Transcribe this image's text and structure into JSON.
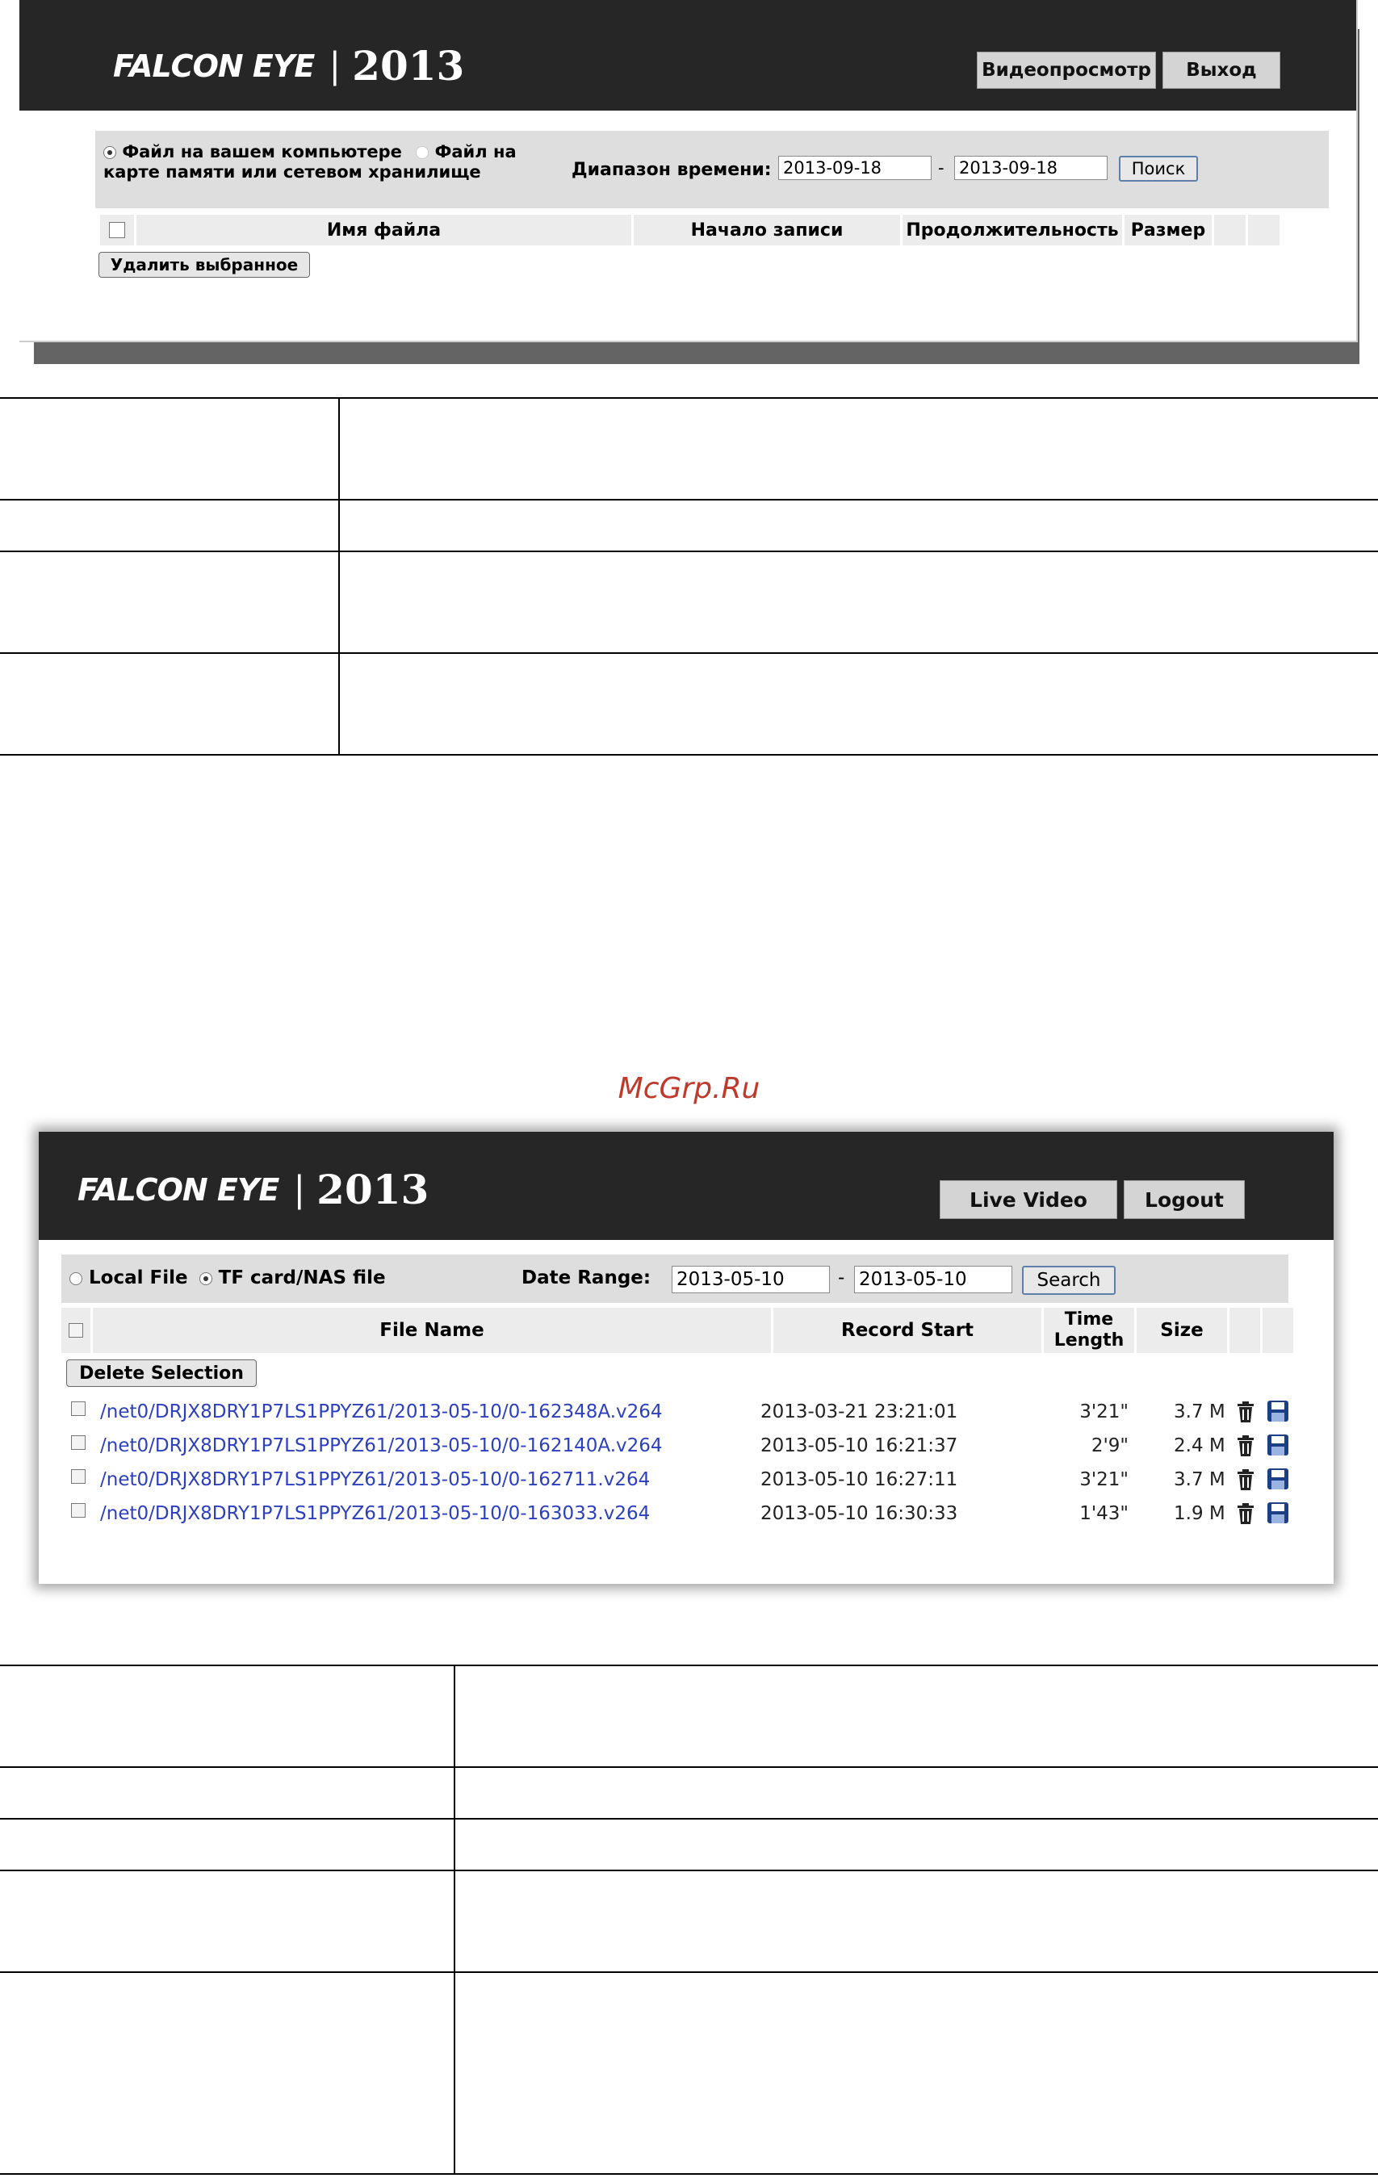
{
  "top_screen": {
    "brand": "FALCON EYE",
    "separator": "|",
    "year": "2013",
    "header_buttons": {
      "live_video": "Видеопросмотр",
      "logout": "Выход"
    },
    "source": {
      "local_label": "Файл на вашем компьютере",
      "nas_label": "Файл на карте памяти или сетевом хранилище",
      "selected": "local"
    },
    "date_range": {
      "label": "Диапазон времени:",
      "from": "2013-09-18",
      "dash": "-",
      "to": "2013-09-18"
    },
    "search_label": "Поиск",
    "columns": {
      "file_name": "Имя файла",
      "record_start": "Начало записи",
      "time_length": "Продолжительность",
      "size": "Размер"
    },
    "delete_label": "Удалить выбранное"
  },
  "watermark": "McGrp.Ru",
  "bottom_screen": {
    "brand": "FALCON EYE",
    "separator": "|",
    "year": "2013",
    "header_buttons": {
      "live_video": "Live Video",
      "logout": "Logout"
    },
    "source": {
      "local_label": "Local File",
      "nas_label": "TF card/NAS file",
      "selected": "nas"
    },
    "date_range": {
      "label": "Date Range:",
      "from": "2013-05-10",
      "dash": "-",
      "to": "2013-05-10"
    },
    "search_label": "Search",
    "columns": {
      "file_name": "File Name",
      "record_start": "Record Start",
      "time_length": "Time Length",
      "size": "Size"
    },
    "delete_label": "Delete Selection",
    "files": [
      {
        "name": "/net0/DRJX8DRY1P7LS1PPYZ61/2013-05-10/0-162348A.v264",
        "record_start": "2013-03-21 23:21:01",
        "length": "3'21\"",
        "size": "3.7 M"
      },
      {
        "name": "/net0/DRJX8DRY1P7LS1PPYZ61/2013-05-10/0-162140A.v264",
        "record_start": "2013-05-10 16:21:37",
        "length": "2'9\"",
        "size": "2.4 M"
      },
      {
        "name": "/net0/DRJX8DRY1P7LS1PPYZ61/2013-05-10/0-162711.v264",
        "record_start": "2013-05-10 16:27:11",
        "length": "3'21\"",
        "size": "3.7 M"
      },
      {
        "name": "/net0/DRJX8DRY1P7LS1PPYZ61/2013-05-10/0-163033.v264",
        "record_start": "2013-05-10 16:30:33",
        "length": "1'43\"",
        "size": "1.9 M"
      }
    ]
  },
  "icons": {
    "delete": "trash-icon",
    "download": "floppy-disk-icon"
  }
}
